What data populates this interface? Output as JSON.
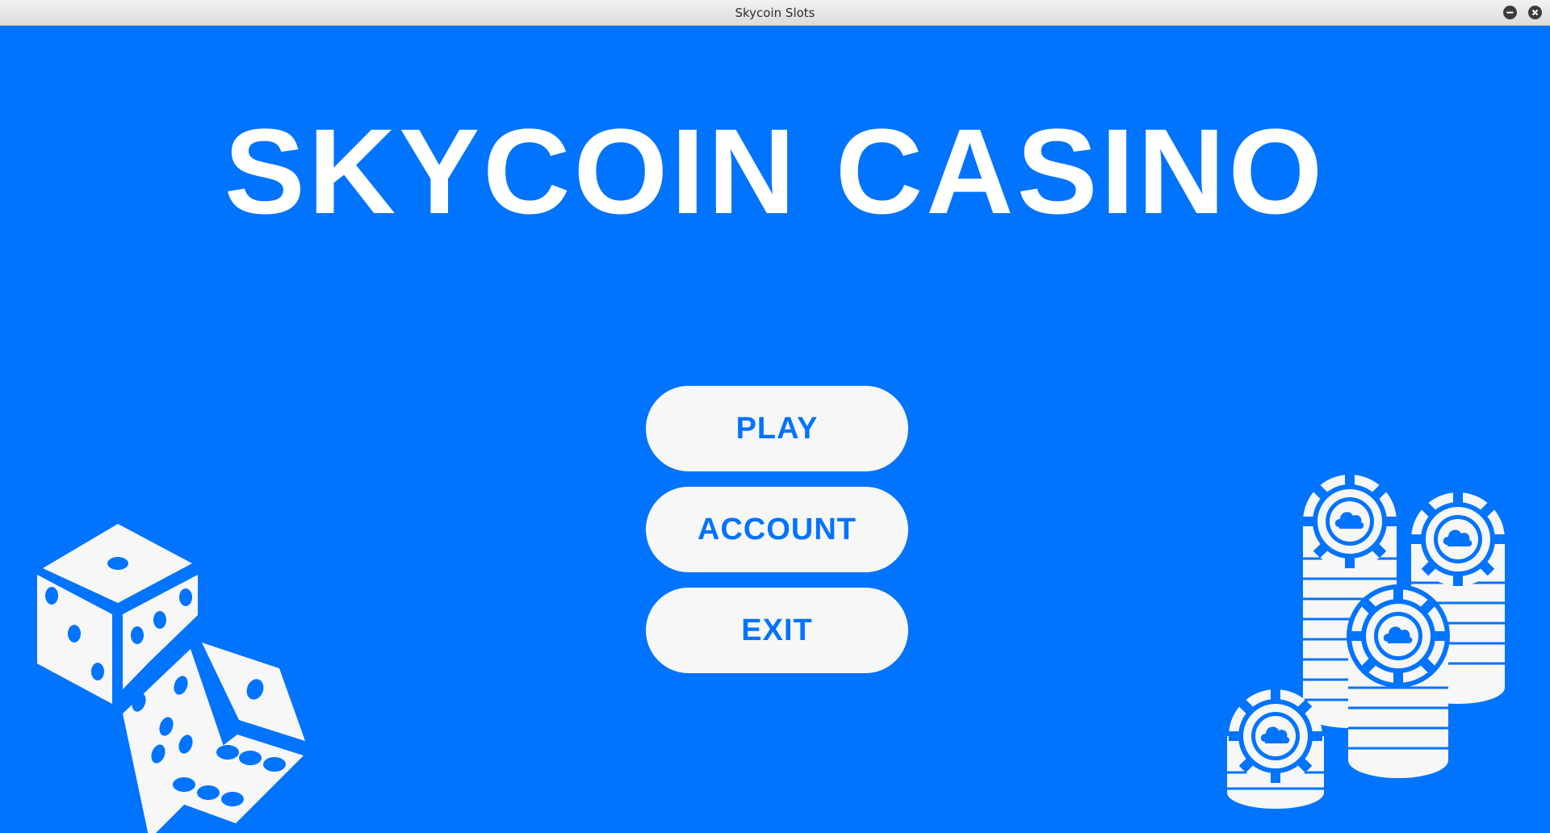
{
  "window": {
    "title": "Skycoin Slots"
  },
  "game": {
    "headline": "SKYCOIN CASINO",
    "menu": {
      "play_label": "PLAY",
      "account_label": "ACCOUNT",
      "exit_label": "EXIT"
    }
  },
  "icons": {
    "minimize": "minimize-icon",
    "close": "close-icon",
    "dice": "dice-icon",
    "chips": "casino-chips-icon"
  },
  "colors": {
    "background": "#0073ff",
    "button_fill": "#f7f7f7",
    "button_text": "#0073ff",
    "headline": "#ffffff"
  }
}
